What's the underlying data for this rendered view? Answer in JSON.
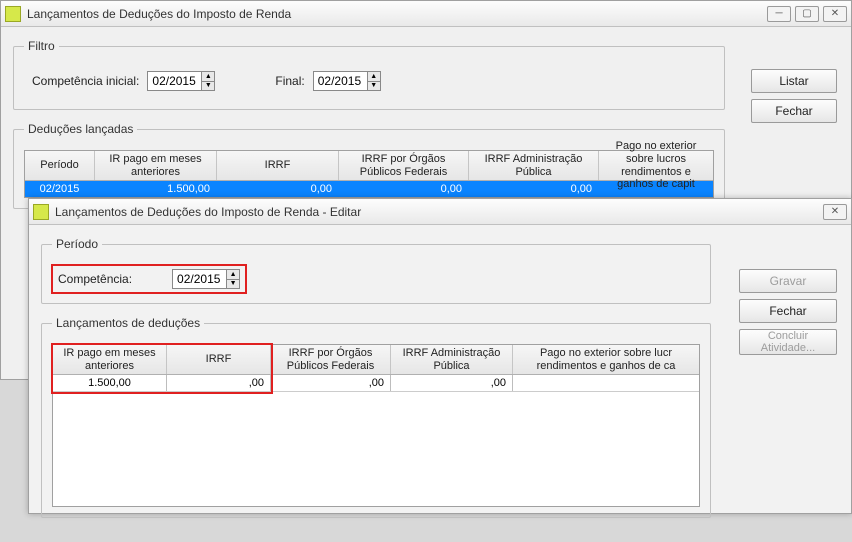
{
  "mainWindow": {
    "title": "Lançamentos de Deduções do Imposto de Renda",
    "filterLegend": "Filtro",
    "compInicialLabel": "Competência inicial:",
    "compInicialValue": "02/2015",
    "compFinalLabel": "Final:",
    "compFinalValue": "02/2015",
    "listarLabel": "Listar",
    "fecharLabel": "Fechar",
    "gridLegend": "Deduções lançadas",
    "gridHeaders": {
      "periodo": "Período",
      "irPago": "IR pago em meses anteriores",
      "irrf": "IRRF",
      "irrfOrgaos": "IRRF por Órgãos Públicos Federais",
      "irrfAdmin": "IRRF Administração Pública",
      "pagoExterior": "Pago no exterior sobre lucros rendimentos e ganhos de capit"
    },
    "gridRow": {
      "periodo": "02/2015",
      "irPago": "1.500,00",
      "irrf": "0,00",
      "irrfOrgaos": "0,00",
      "irrfAdmin": "0,00",
      "pagoExterior": ""
    }
  },
  "editWindow": {
    "title": "Lançamentos de Deduções do Imposto de Renda - Editar",
    "periodoLegend": "Período",
    "competenciaLabel": "Competência:",
    "competenciaValue": "02/2015",
    "gravarLabel": "Gravar",
    "fecharLabel": "Fechar",
    "concluirLabel": "Concluir Atividade...",
    "gridLegend": "Lançamentos de deduções",
    "gridHeaders": {
      "irPago": "IR pago em meses anteriores",
      "irrf": "IRRF",
      "irrfOrgaos": "IRRF por Órgãos Públicos Federais",
      "irrfAdmin": "IRRF Administração Pública",
      "pagoExterior": "Pago no exterior sobre lucr rendimentos e ganhos de ca"
    },
    "gridRow": {
      "irPago": "1.500,00",
      "irrf": ",00",
      "irrfOrgaos": ",00",
      "irrfAdmin": ",00",
      "pagoExterior": ""
    }
  }
}
